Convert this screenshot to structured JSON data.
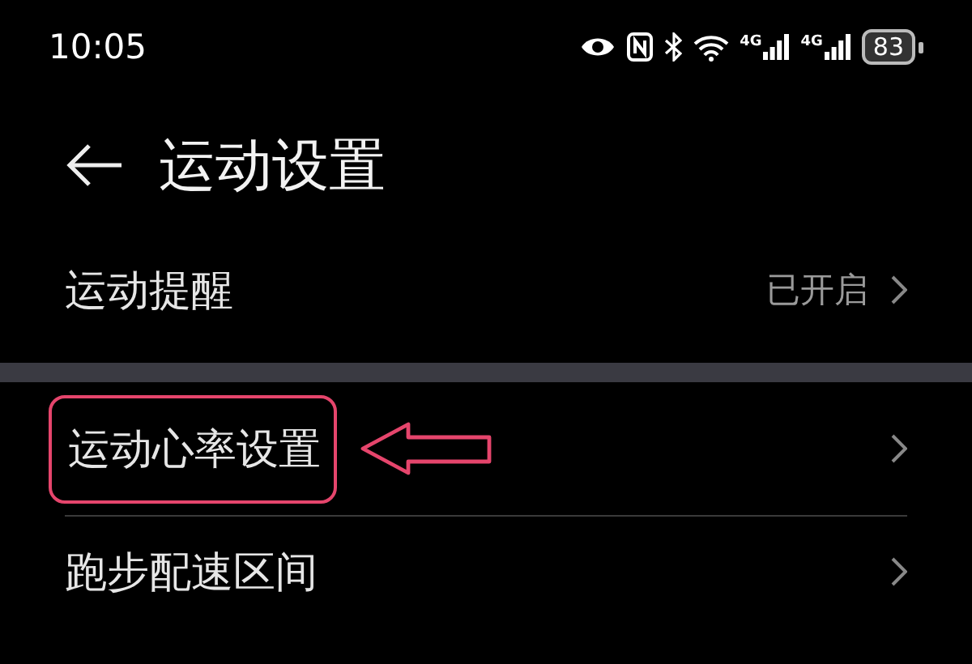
{
  "status_bar": {
    "time": "10:05",
    "signals": [
      {
        "label": "4G"
      },
      {
        "label": "4G"
      }
    ],
    "battery": "83"
  },
  "header": {
    "title": "运动设置"
  },
  "sections": [
    {
      "rows": [
        {
          "label": "运动提醒",
          "value": "已开启",
          "highlighted": false
        }
      ]
    },
    {
      "rows": [
        {
          "label": "运动心率设置",
          "highlighted": true
        },
        {
          "label": "跑步配速区间",
          "highlighted": false
        }
      ]
    }
  ]
}
